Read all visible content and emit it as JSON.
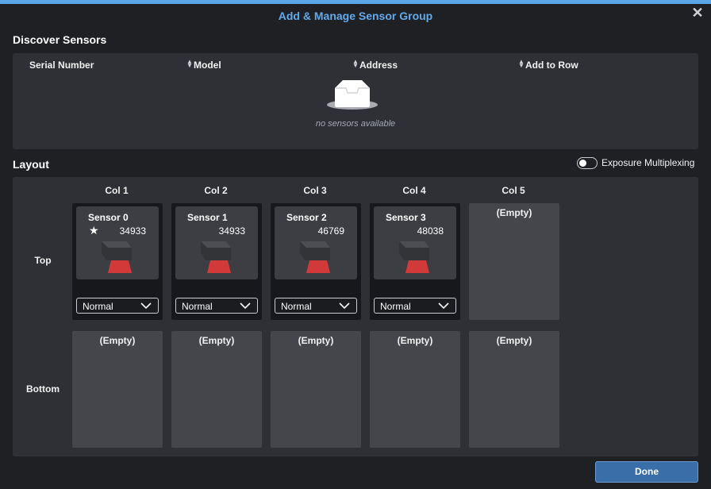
{
  "dialog": {
    "title": "Add & Manage Sensor Group"
  },
  "discover": {
    "heading": "Discover Sensors",
    "columns": [
      "Serial Number",
      "Model",
      "Address",
      "Add to Row"
    ],
    "empty_message": "no sensors available"
  },
  "layout": {
    "heading": "Layout",
    "exposure_multiplexing": {
      "label": "Exposure Multiplexing",
      "enabled": false
    },
    "columns": [
      "Col 1",
      "Col 2",
      "Col 3",
      "Col 4",
      "Col 5"
    ],
    "rows": [
      "Top",
      "Bottom"
    ],
    "empty_label": "(Empty)",
    "top": [
      {
        "name": "Sensor 0",
        "serial": "34933",
        "starred": true,
        "mode": "Normal"
      },
      {
        "name": "Sensor 1",
        "serial": "34933",
        "starred": false,
        "mode": "Normal"
      },
      {
        "name": "Sensor 2",
        "serial": "46769",
        "starred": false,
        "mode": "Normal"
      },
      {
        "name": "Sensor 3",
        "serial": "48038",
        "starred": false,
        "mode": "Normal"
      }
    ],
    "star_glyph": "★"
  },
  "footer": {
    "done_label": "Done"
  },
  "colors": {
    "accent": "#62aaec",
    "sensor_beam": "#d23a3a",
    "done_button": "#3a6ea8"
  },
  "icons": {
    "close": "close-icon",
    "empty_tray": "empty-tray-icon",
    "sensor": "sensor-icon",
    "chevron": "chevron-down-icon",
    "sort": "sort-icon"
  }
}
